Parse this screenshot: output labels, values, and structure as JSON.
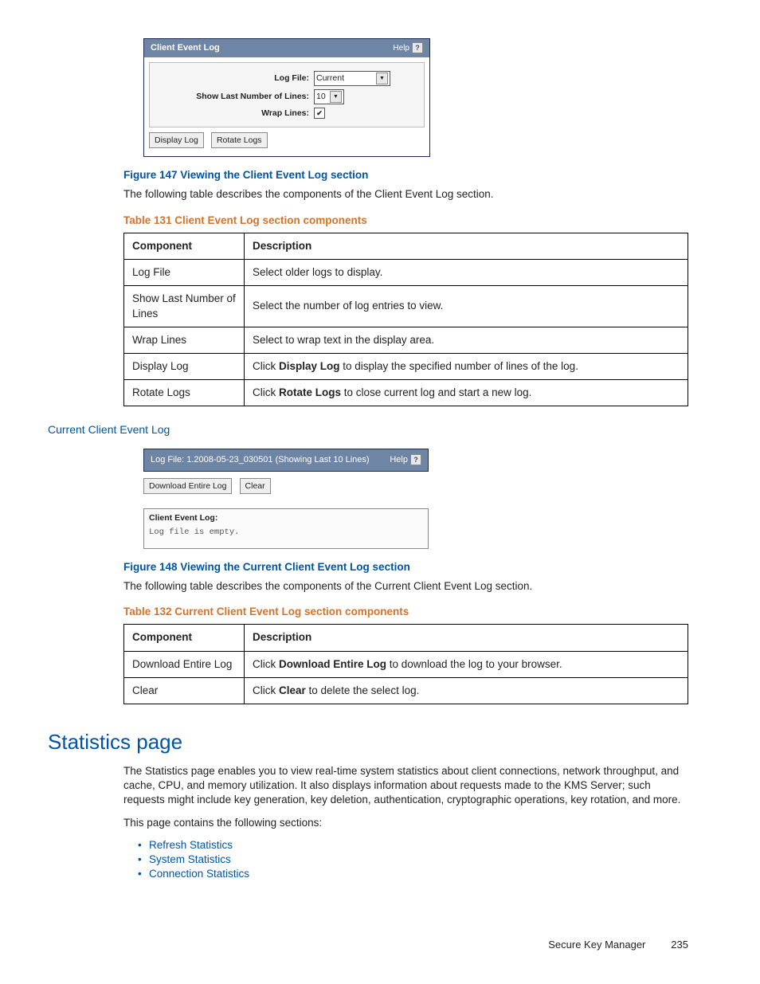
{
  "screenshot1": {
    "title": "Client Event Log",
    "help": "Help",
    "fields": {
      "logfile_label": "Log File:",
      "logfile_value": "Current",
      "lines_label": "Show Last Number of Lines:",
      "lines_value": "10",
      "wrap_label": "Wrap Lines:",
      "wrap_checked": "✔"
    },
    "buttons": {
      "display": "Display Log",
      "rotate": "Rotate Logs"
    }
  },
  "fig147": "Figure 147 Viewing the Client Event Log section",
  "fig147_desc": "The following table describes the components of the Client Event Log section.",
  "table131_caption": "Table 131 Client Event Log section components",
  "table131": {
    "headers": [
      "Component",
      "Description"
    ],
    "rows": [
      [
        "Log File",
        "Select older logs to display."
      ],
      [
        "Show Last Number of Lines",
        "Select the number of log entries to view."
      ],
      [
        "Wrap Lines",
        "Select to wrap text in the display area."
      ],
      [
        "Display Log",
        {
          "pre": "Click ",
          "b": "Display Log",
          "post": " to display the specified number of lines of the log."
        }
      ],
      [
        "Rotate Logs",
        {
          "pre": "Click ",
          "b": "Rotate Logs",
          "post": " to close current log and start a new log."
        }
      ]
    ]
  },
  "section_link1": "Current Client Event Log",
  "screenshot2": {
    "title": "Log File: 1.2008-05-23_030501 (Showing Last 10 Lines)",
    "help": "Help",
    "buttons": {
      "download": "Download Entire Log",
      "clear": "Clear"
    },
    "box_title": "Client Event Log:",
    "box_body": "Log file is empty."
  },
  "fig148": "Figure 148 Viewing the Current Client Event Log section",
  "fig148_desc": "The following table describes the components of the Current Client Event Log section.",
  "table132_caption": "Table 132 Current Client Event Log section components",
  "table132": {
    "headers": [
      "Component",
      "Description"
    ],
    "rows": [
      [
        "Download Entire Log",
        {
          "pre": "Click ",
          "b": "Download Entire Log",
          "post": " to download the log to your browser."
        }
      ],
      [
        "Clear",
        {
          "pre": "Click ",
          "b": "Clear",
          "post": " to delete the select log."
        }
      ]
    ]
  },
  "stats_heading": "Statistics page",
  "stats_para": "The Statistics page enables you to view real-time system statistics about client connections, network throughput, and cache, CPU, and memory utilization. It also displays information about requests made to the KMS Server; such requests might include key generation, key deletion, authentication, cryptographic operations, key rotation, and more.",
  "stats_lead": "This page contains the following sections:",
  "stats_links": [
    "Refresh Statistics",
    "System Statistics",
    "Connection Statistics"
  ],
  "footer": {
    "product": "Secure Key Manager",
    "page": "235"
  }
}
